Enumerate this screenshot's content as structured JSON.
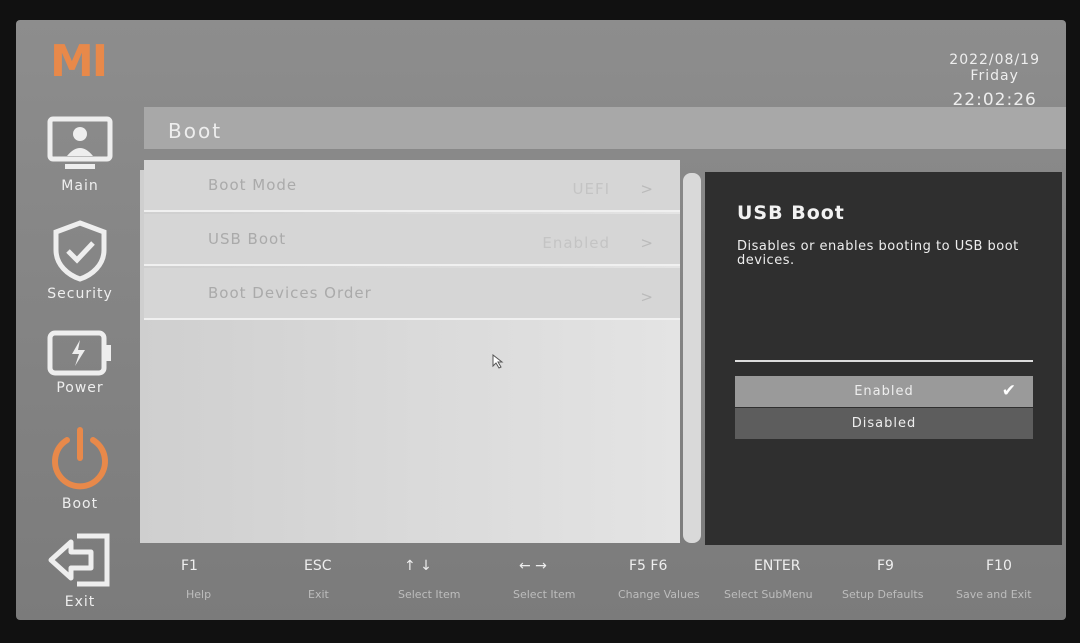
{
  "brand": {
    "logo": "MI",
    "accent": "#e8894a"
  },
  "datetime": {
    "date": "2022/08/19",
    "day": "Friday",
    "time": "22:02:26"
  },
  "sidebar": {
    "items": [
      {
        "label": "Main",
        "icon": "monitor-user-icon"
      },
      {
        "label": "Security",
        "icon": "shield-check-icon"
      },
      {
        "label": "Power",
        "icon": "battery-icon"
      },
      {
        "label": "Boot",
        "icon": "power-icon",
        "active": true
      },
      {
        "label": "Exit",
        "icon": "exit-arrow-icon"
      }
    ]
  },
  "page": {
    "title": "Boot"
  },
  "settings": [
    {
      "label": "Boot Mode",
      "value": "UEFI",
      "chevron": ">"
    },
    {
      "label": "USB Boot",
      "value": "Enabled",
      "chevron": ">"
    },
    {
      "label": "Boot Devices Order",
      "value": "",
      "chevron": ">"
    }
  ],
  "help": {
    "title": "USB Boot",
    "description": "Disables or enables booting to USB boot devices.",
    "options": [
      {
        "label": "Enabled",
        "selected": true
      },
      {
        "label": "Disabled",
        "selected": false
      }
    ]
  },
  "footer": {
    "keys": [
      {
        "key": "F1",
        "desc": "Help"
      },
      {
        "key": "ESC",
        "desc": "Exit"
      },
      {
        "key": "↑  ↓",
        "desc": "Select Item"
      },
      {
        "key": "←  →",
        "desc": "Select Item"
      },
      {
        "key": "F5  F6",
        "desc": "Change Values"
      },
      {
        "key": "ENTER",
        "desc": "Select SubMenu"
      },
      {
        "key": "F9",
        "desc": "Setup Defaults"
      },
      {
        "key": "F10",
        "desc": "Save and Exit"
      }
    ]
  }
}
